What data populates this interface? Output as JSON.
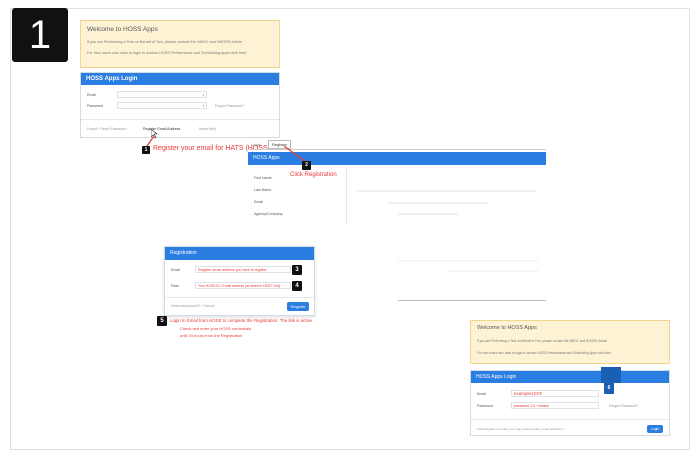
{
  "step_number": "1",
  "login_top": {
    "welcome_title": "Welcome to HOSS Apps",
    "welcome_line1": "If you are Performing a Test on Behalf of Two, please contact the NMOC and NHOSS Admin",
    "welcome_line2": "For new users who wish to login to access HOSS Performance and Scheduling Apps click here",
    "header": "HOSS Apps Login",
    "email_label": "Email",
    "password_label": "Password",
    "forgot_link": "Forgot Password?",
    "footer_text": "Forgot / Reset Password",
    "register_link": "Register Email Address",
    "help_link": "Need Help"
  },
  "register_panel": {
    "tab1": "Login",
    "tab2": "Register",
    "header": "HOSS Apps",
    "row1": "First Name",
    "row2": "Last Name",
    "row3": "Email",
    "row4": "Agency/Company"
  },
  "registration_dialog": {
    "header": "Registration",
    "email_label": "Email",
    "email_value": "Register email address you wish to register",
    "pass_label": "Pass",
    "pass_value": "Your HOSS ID / Email address (as listed in HSST Tool)",
    "footer_text": "Need an Account? / Cancel",
    "register_button": "Register"
  },
  "login_bottom": {
    "welcome_title": "Welcome to HOSS Apps",
    "welcome_line1": "If you are Performing a Test on Behalf of Two, please contact the NMOC and NHOSS Admin",
    "welcome_line2": "For new users who wish to login to access HOSS Performance and Scheduling Apps click here",
    "header": "HOSS Apps Login",
    "email_label": "Email",
    "password_label": "Password",
    "email_value": "example123!!!",
    "password_value": "password 1/1 ! hidden",
    "forgot_link": "Forgot Password?",
    "footer_text": "Click Register to create your login address after email verification",
    "login_button": "Login"
  },
  "annotations": {
    "a1_num": "1",
    "a1_text": "Register your email for HATS (HOSS",
    "a2_num": "2",
    "a2_text": "Click Registration",
    "a3_num": "3",
    "a4_num": "4",
    "a5_num": "5",
    "a5_line1": "Login to Email from HOSS to complete the Registration. The link is active",
    "a5_line2": "Check and enter your HOSS credentials",
    "a5_line3": "until 24 hours from the Registration",
    "a6_num": "6"
  }
}
